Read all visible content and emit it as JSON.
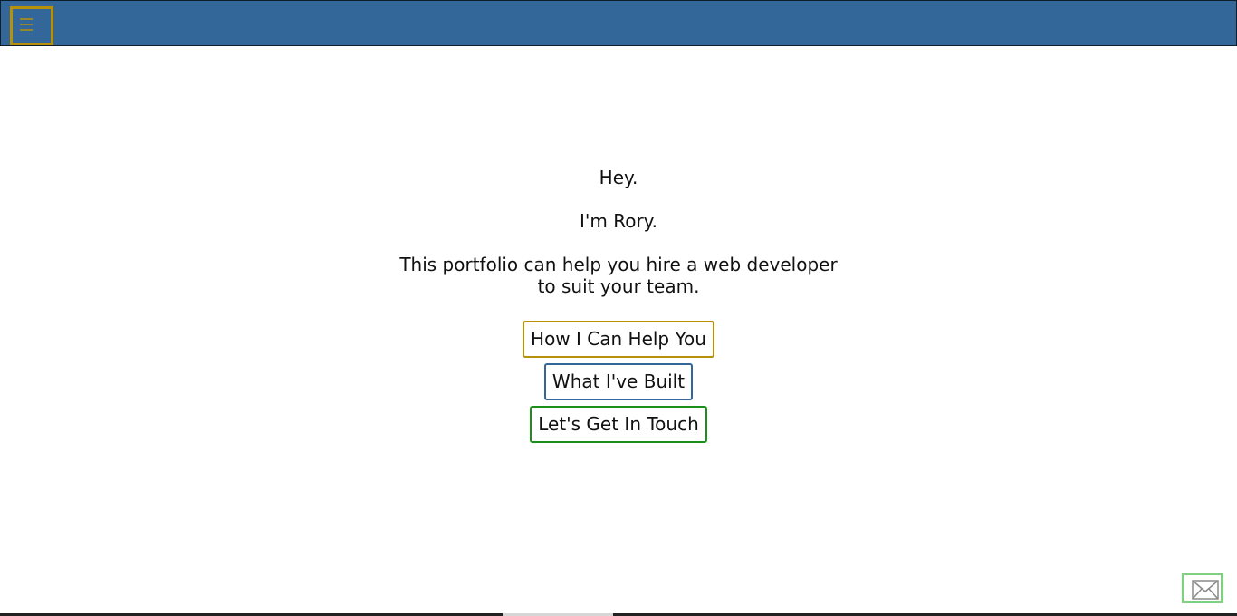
{
  "header": {
    "menu_icon": "hamburger-menu-icon",
    "background_color": "#336699",
    "accent_color": "#b8900a"
  },
  "hero": {
    "greeting": "Hey.",
    "intro": "I'm Rory.",
    "pitch_line1": "This portfolio can help you hire a web developer",
    "pitch_line2": "to suit your team."
  },
  "actions": {
    "help_label": "How I Can Help You",
    "built_label": "What I've Built",
    "touch_label": "Let's Get In Touch",
    "help_color": "#b8900a",
    "built_color": "#336699",
    "touch_color": "#1a8f1a"
  },
  "contact": {
    "mail_icon": "envelope-icon",
    "border_color": "#7fd17f"
  }
}
